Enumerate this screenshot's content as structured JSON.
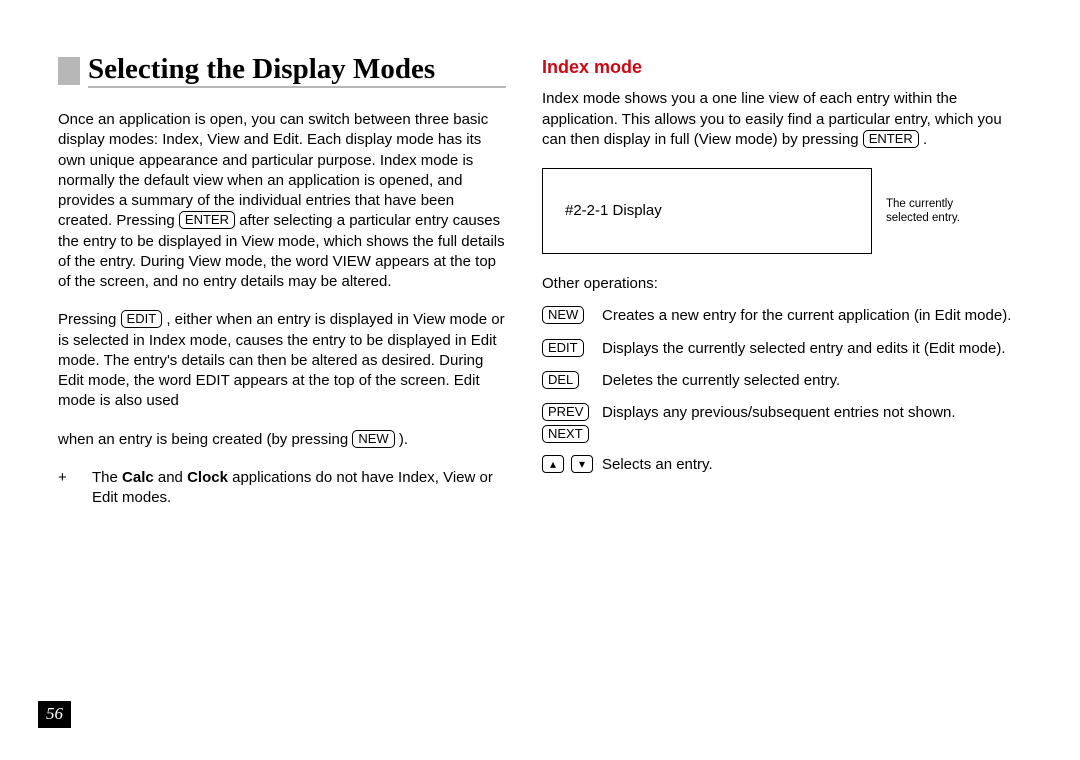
{
  "pageNumber": "56",
  "left": {
    "title": "Selecting the Display Modes",
    "p1a": "Once an application is open, you can switch between three basic display modes: Index, View and Edit. Each display mode has its own unique appearance and particular purpose. Index mode is normally the default view when an application is opened, and provides a summary of the individual entries that have been created. Pressing ",
    "p1_key": "ENTER",
    "p1b": " after selecting a particular entry causes the entry to be displayed in View mode, which shows the full details of the entry. During View mode, the word VIEW appears at the top of the screen, and no entry details may be altered.",
    "p2a": "Pressing ",
    "p2_key": "EDIT",
    "p2b": " , either when an entry is displayed in View mode or is selected in Index mode, causes the entry to be displayed in Edit mode. The entry's details can then be altered as desired. During Edit mode, the word EDIT appears at the top of the screen. Edit mode is also used",
    "p3a": "when an entry is being created (by pressing ",
    "p3_key": "NEW",
    "p3b": " ).",
    "note_plus": "+",
    "note_a": "The ",
    "note_b1": "Calc",
    "note_mid": " and ",
    "note_b2": "Clock",
    "note_c": " applications do not have Index, View or Edit modes."
  },
  "right": {
    "heading": "Index mode",
    "introA": "Index mode shows you a one line view of each entry within the application. This allows you to easily find a particular entry, which you can then display in full (View mode) by pressing ",
    "intro_key": "ENTER",
    "introB": " .",
    "box_text": "#2-2-1 Display",
    "box_caption": "The currently selected entry.",
    "ops_label": "Other operations:",
    "ops": [
      {
        "keys": [
          "NEW"
        ],
        "desc": "Creates a new entry for the current application (in Edit mode)."
      },
      {
        "keys": [
          "EDIT"
        ],
        "desc": "Displays the currently selected entry and edits it (Edit mode)."
      },
      {
        "keys": [
          "DEL"
        ],
        "desc": "Deletes the currently selected entry."
      },
      {
        "keys": [
          "PREV",
          "NEXT"
        ],
        "desc": "Displays any previous/subsequent entries not shown."
      }
    ],
    "arrows_desc": "Selects an entry.",
    "arrow_up": "▴",
    "arrow_down": "▾"
  }
}
